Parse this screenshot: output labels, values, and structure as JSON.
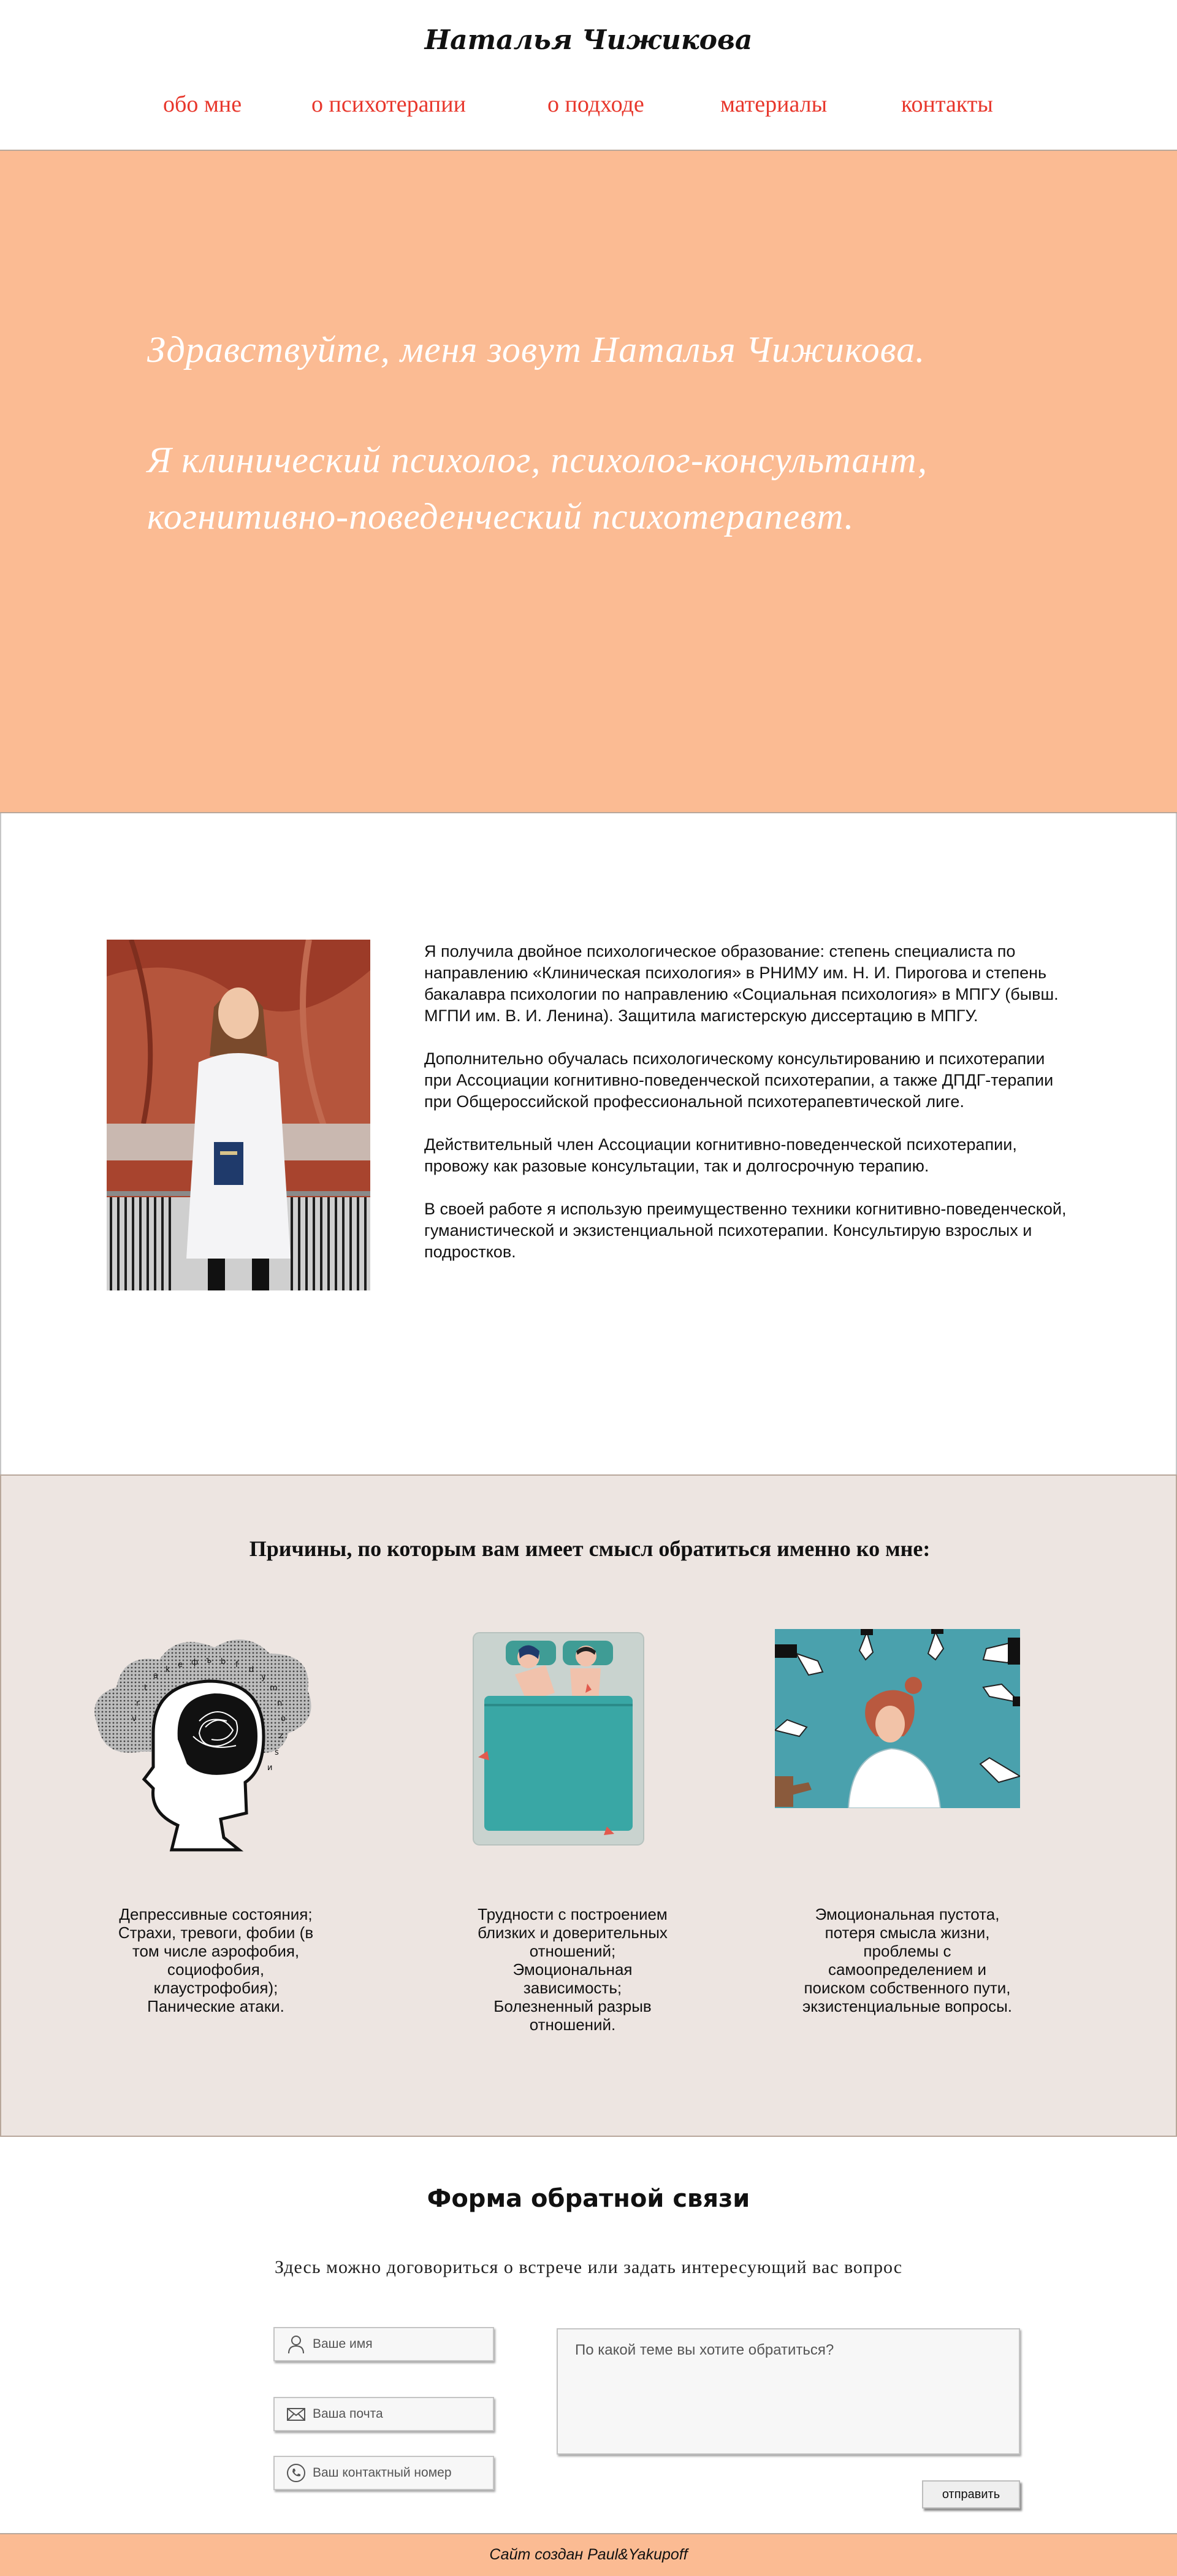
{
  "header": {
    "site_title": "Наталья Чижикова",
    "nav": [
      {
        "label": "обо мне"
      },
      {
        "label": "о психотерапии"
      },
      {
        "label": "о подходе"
      },
      {
        "label": "материалы"
      },
      {
        "label": "контакты"
      }
    ],
    "nav_color": "#e8372c"
  },
  "hero": {
    "greeting": "Здравствуйте, меня зовут Наталья Чижикова.",
    "intro_line1": "Я клинический психолог, психолог-консультант,",
    "intro_line2": "когнитивно-поведенческий психотерапевт.",
    "background": "#fbbb93"
  },
  "about": {
    "photo_icon": "portrait-photo",
    "paragraphs": [
      "Я получила двойное психологическое образование: степень специалиста по направлению «Клиническая психология» в РНИМУ им. Н. И. Пирогова и степень бакалавра психологии по направлению «Социальная психология» в МПГУ (бывш. МГПИ им. В. И. Ленина). Защитила магистерскую диссертацию в МПГУ.",
      "Дополнительно обучалась психологическому консультированию и психотерапии при Ассоциации когнитивно-поведенческой психотерапии, а также ДПДГ-терапии при Общероссийской профессиональной психотерапевтической лиге.",
      "Действительный член Ассоциации когнитивно-поведенческой психотерапии, провожу как разовые консультации, так и долгосрочную терапию.",
      "В своей работе я использую преимущественно техники когнитивно-поведенческой, гуманистической и экзистенциальной психотерапии. Консультирую взрослых и подростков."
    ]
  },
  "reasons": {
    "title": "Причины, по которым вам имеет смысл обратиться именно ко мне:",
    "items": [
      {
        "icon": "head-cloud-illustration",
        "text": "Депрессивные состояния;\nСтрахи, тревоги, фобии (в том числе аэрофобия, социофобия, клаустрофобия);\nПанические атаки."
      },
      {
        "icon": "couple-bed-illustration",
        "text": "Трудности с построением близких и доверительных отношений;\nЭмоциональная зависимость;\nБолезненный разрыв отношений."
      },
      {
        "icon": "pointing-fingers-illustration",
        "text": "Эмоциональная пустота,\nпотеря смысла жизни,\nпроблемы с самоопределением и поиском собственного пути,\nэкзистенциальные вопросы."
      }
    ],
    "background": "#ede5e1"
  },
  "feedback": {
    "title": "Форма обратной связи",
    "subtitle": "Здесь можно договориться о встрече или задать интересующий вас вопрос",
    "name_placeholder": "Ваше имя",
    "email_placeholder": "Ваша почта",
    "phone_placeholder": "Ваш контактный номер",
    "message_placeholder": "По какой теме вы хотите обратиться?",
    "send_label": "отправить"
  },
  "footer": {
    "text": "Сайт создан Paul&Yakupoff"
  }
}
